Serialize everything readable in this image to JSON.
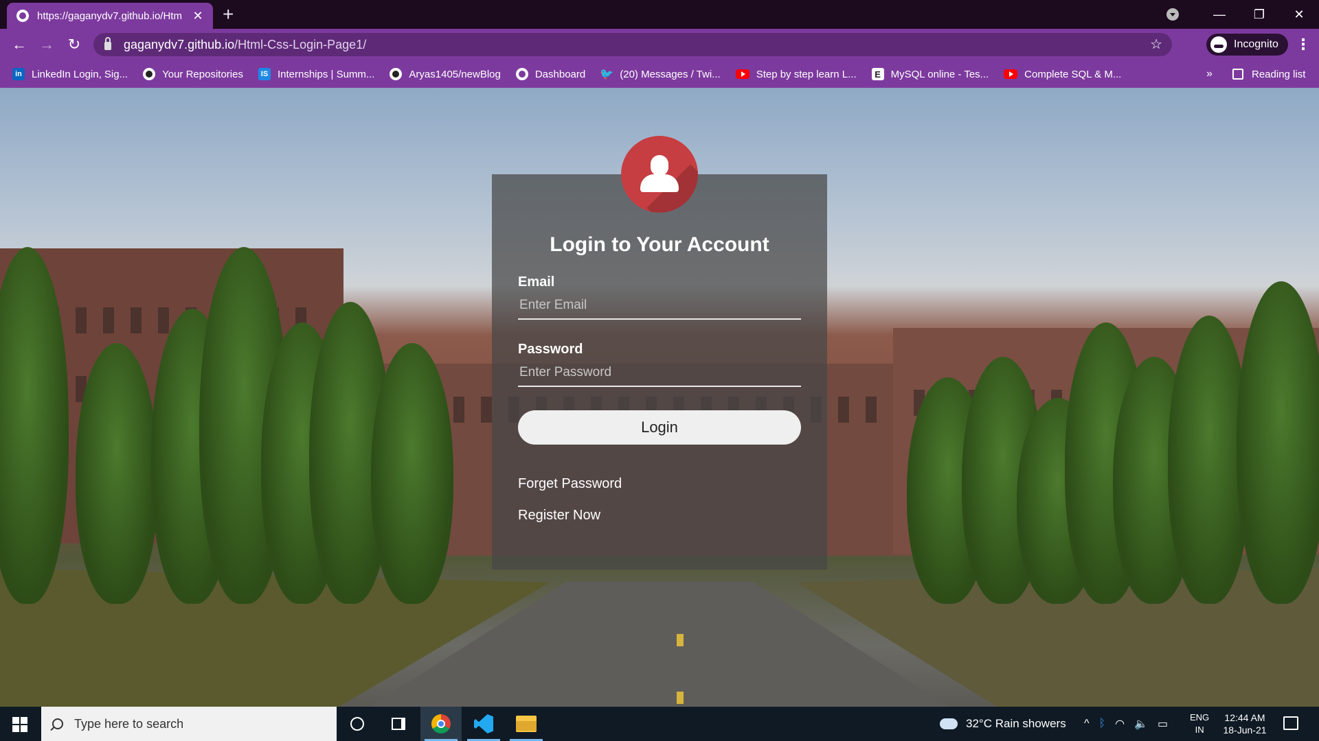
{
  "browser": {
    "tab_title": "https://gaganydv7.github.io/Htm",
    "tab_close": "✕",
    "new_tab": "+",
    "url_host": "gaganydv7.github.io",
    "url_path": "/Html-Css-Login-Page1/",
    "incognito_label": "Incognito",
    "bookmarks": [
      {
        "label": "LinkedIn Login, Sig...",
        "icon": "linkedin-icon"
      },
      {
        "label": "Your Repositories",
        "icon": "github-icon"
      },
      {
        "label": "Internships | Summ...",
        "icon": "internshala-icon"
      },
      {
        "label": "Aryas1405/newBlog",
        "icon": "github-icon"
      },
      {
        "label": "Dashboard",
        "icon": "globe-icon"
      },
      {
        "label": "(20) Messages / Twi...",
        "icon": "twitter-icon"
      },
      {
        "label": "Step by step learn L...",
        "icon": "youtube-icon"
      },
      {
        "label": "MySQL online - Tes...",
        "icon": "e-icon"
      },
      {
        "label": "Complete SQL & M...",
        "icon": "youtube-icon"
      }
    ],
    "more_bookmarks": "»",
    "reading_list": "Reading list"
  },
  "login": {
    "title": "Login to Your Account",
    "email_label": "Email",
    "email_placeholder": "Enter Email",
    "password_label": "Password",
    "password_placeholder": "Enter Password",
    "login_button": "Login",
    "forget_password": "Forget Password",
    "register_now": "Register Now",
    "accent_color": "#c63e42"
  },
  "taskbar": {
    "search_placeholder": "Type here to search",
    "weather": "32°C  Rain showers",
    "lang_line1": "ENG",
    "lang_line2": "IN",
    "time": "12:44 AM",
    "date": "18-Jun-21"
  }
}
